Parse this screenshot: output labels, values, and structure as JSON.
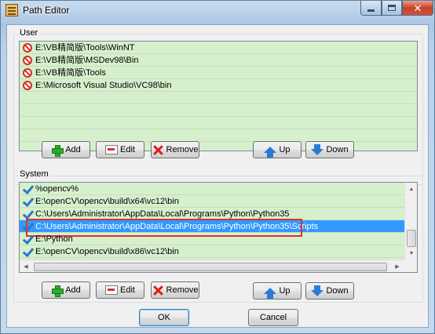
{
  "window": {
    "title": "Path Editor"
  },
  "user": {
    "label": "User",
    "items": [
      "E:\\VB精简版\\Tools\\WinNT",
      "E:\\VB精简版\\MSDev98\\Bin",
      "E:\\VB精简版\\Tools",
      "E:\\Microsoft Visual Studio\\VC98\\bin"
    ]
  },
  "system": {
    "label": "System",
    "items": [
      "%opencv%",
      "E:\\openCV\\opencv\\build\\x64\\vc12\\bin",
      "C:\\Users\\Administrator\\AppData\\Local\\Programs\\Python\\Python35",
      "C:\\Users\\Administrator\\AppData\\Local\\Programs\\Python\\Python35\\Scripts",
      "E:\\Python",
      "E:\\openCV\\opencv\\build\\x86\\vc12\\bin"
    ],
    "selected_index": 3
  },
  "buttons": {
    "add": "Add",
    "edit": "Edit",
    "remove": "Remove",
    "up": "Up",
    "down": "Down",
    "ok": "OK",
    "cancel": "Cancel"
  },
  "colors": {
    "list_bg": "#d6f0ce",
    "selection": "#3399ff",
    "annotation": "#e03030"
  }
}
